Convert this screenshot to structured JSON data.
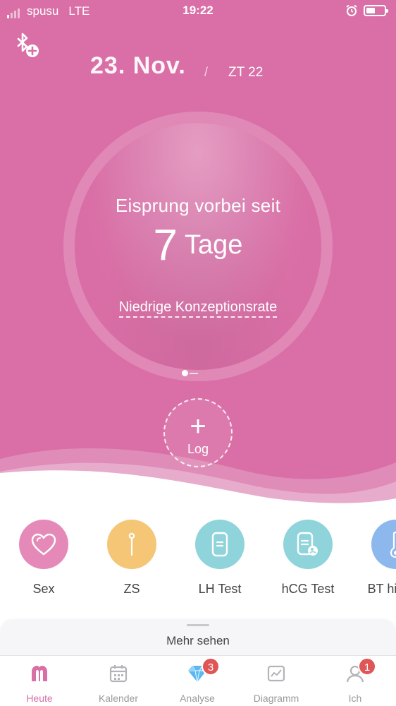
{
  "status_bar": {
    "carrier": "spusu",
    "network": "LTE",
    "time": "19:22"
  },
  "header": {
    "date": "23. Nov.",
    "separator": "/",
    "cycle_day": "ZT 22"
  },
  "cycle_circle": {
    "status_text": "Eisprung vorbei seit",
    "days_value": "7",
    "days_unit": "Tage",
    "conception_rate": "Niedrige Konzeptionsrate"
  },
  "log_button": {
    "plus": "+",
    "label": "Log"
  },
  "quick_actions": [
    {
      "label": "Sex",
      "color": "#e58ab8"
    },
    {
      "label": "ZS",
      "color": "#f4c676"
    },
    {
      "label": "LH Test",
      "color": "#8fd4da"
    },
    {
      "label": "hCG Test",
      "color": "#8fd4da"
    },
    {
      "label": "BT hinzuf.",
      "color": "#8cb8ee"
    }
  ],
  "more_panel": {
    "label": "Mehr sehen"
  },
  "tab_bar": {
    "tabs": [
      {
        "label": "Heute",
        "active": true
      },
      {
        "label": "Kalender"
      },
      {
        "label": "Analyse",
        "badge": "3"
      },
      {
        "label": "Diagramm"
      },
      {
        "label": "Ich",
        "badge": "1"
      }
    ]
  },
  "colors": {
    "accent": "#d96fa6",
    "badge": "#e05555"
  }
}
